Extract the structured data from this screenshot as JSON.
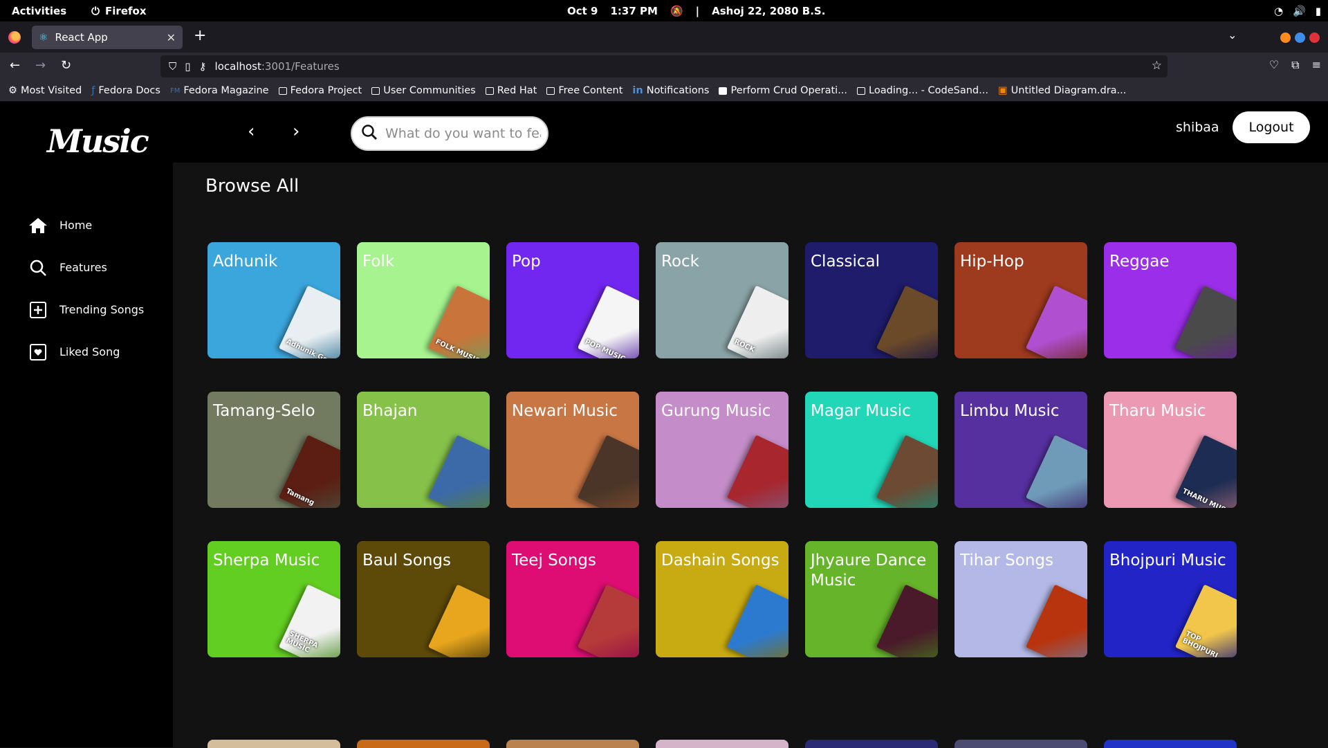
{
  "gnome": {
    "activities": "Activities",
    "app": "Firefox",
    "date": "Oct 9",
    "time": "1:37 PM",
    "separator": "|",
    "bs_date": "Ashoj 22, 2080 B.S."
  },
  "browser": {
    "tab_title": "React App",
    "url_host": "localhost",
    "url_path": ":3001/Features",
    "bookmarks": [
      "Most Visited",
      "Fedora Docs",
      "Fedora Magazine",
      "Fedora Project",
      "User Communities",
      "Red Hat",
      "Free Content",
      "Notifications",
      "Perform Crud Operati...",
      "Loading... - CodeSand...",
      "Untitled Diagram.dra..."
    ]
  },
  "app": {
    "logo": "Music",
    "nav": [
      {
        "label": "Home",
        "icon": "home-icon"
      },
      {
        "label": "Features",
        "icon": "search-icon"
      },
      {
        "label": "Trending Songs",
        "icon": "plus-square-icon"
      },
      {
        "label": "Liked Song",
        "icon": "heart-square-icon"
      }
    ],
    "search_placeholder": "What do you want to feature?",
    "username": "shibaa",
    "logout": "Logout",
    "title": "Browse All",
    "cards": [
      {
        "label": "Adhunik",
        "bg": "#3ba6dc",
        "art": "#e8eef2",
        "art_text": "Adhunik Geet"
      },
      {
        "label": "Folk",
        "bg": "#a6f38f",
        "art": "#c9743a",
        "art_text": "FOLK MUSIC"
      },
      {
        "label": "Pop",
        "bg": "#7227f0",
        "art": "#f5f5f5",
        "art_text": "POP MUSIC"
      },
      {
        "label": "Rock",
        "bg": "#8aa3a6",
        "art": "#eeeeee",
        "art_text": "ROCK"
      },
      {
        "label": "Classical",
        "bg": "#1e1c6b",
        "art": "#6b4a2a",
        "art_text": ""
      },
      {
        "label": "Hip-Hop",
        "bg": "#9e3a1e",
        "art": "#b04fcf",
        "art_text": ""
      },
      {
        "label": "Reggae",
        "bg": "#9b2ee8",
        "art": "#4a4a4a",
        "art_text": ""
      },
      {
        "label": "Tamang-Selo",
        "bg": "#727a5f",
        "art": "#5c1e12",
        "art_text": "Tamang"
      },
      {
        "label": "Bhajan",
        "bg": "#86c24a",
        "art": "#3c6aa8",
        "art_text": ""
      },
      {
        "label": "Newari Music",
        "bg": "#c87644",
        "art": "#4a3528",
        "art_text": ""
      },
      {
        "label": "Gurung Music",
        "bg": "#c48cc8",
        "art": "#a8262e",
        "art_text": ""
      },
      {
        "label": "Magar Music",
        "bg": "#22d6b8",
        "art": "#6d4a33",
        "art_text": ""
      },
      {
        "label": "Limbu Music",
        "bg": "#5730a0",
        "art": "#6f9bb8",
        "art_text": ""
      },
      {
        "label": "Tharu Music",
        "bg": "#ec9ab4",
        "art": "#1d2c52",
        "art_text": "THARU MUSIC"
      },
      {
        "label": "Sherpa Music",
        "bg": "#63ce22",
        "art": "#f2f2f2",
        "art_text": "SHERPA MUSIC"
      },
      {
        "label": "Baul Songs",
        "bg": "#5e4a08",
        "art": "#e8a61e",
        "art_text": ""
      },
      {
        "label": "Teej Songs",
        "bg": "#dd0d73",
        "art": "#b53a3a",
        "art_text": ""
      },
      {
        "label": "Dashain Songs",
        "bg": "#c8ab12",
        "art": "#2c7ad0",
        "art_text": ""
      },
      {
        "label": "Jhyaure Dance Music",
        "bg": "#66b42a",
        "art": "#4a1a2a",
        "art_text": ""
      },
      {
        "label": "Tihar Songs",
        "bg": "#b3b8e6",
        "art": "#b8340e",
        "art_text": ""
      },
      {
        "label": "Bhojpuri Music",
        "bg": "#2224c6",
        "art": "#f1c64a",
        "art_text": "TOP BHOJPURI"
      }
    ],
    "partial_colors": [
      "#d3bd9a",
      "#c86a17",
      "#b9824f",
      "#d5b4c9",
      "#2a2a75",
      "#4c4b72",
      "#2234c8"
    ]
  }
}
